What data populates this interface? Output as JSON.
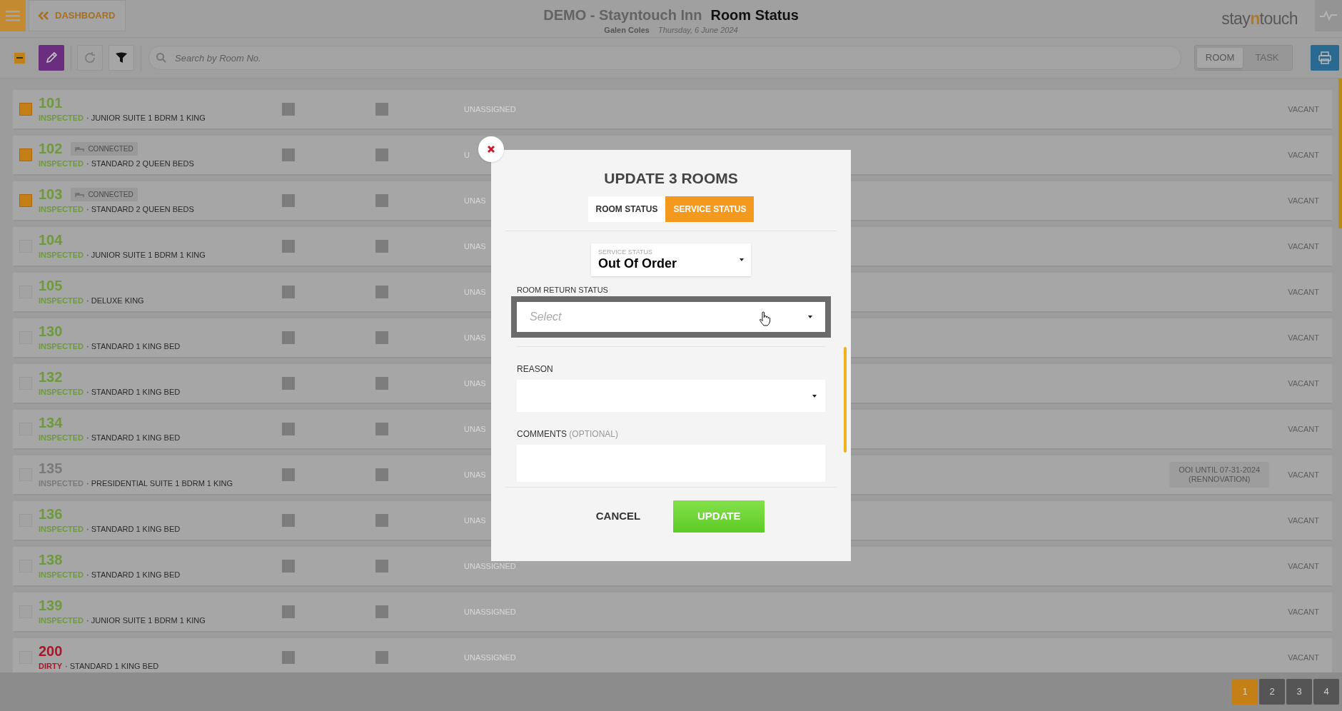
{
  "header": {
    "back_link": "DASHBOARD",
    "hotel": "DEMO - Stayntouch Inn",
    "page_title": "Room Status",
    "user": "Galen Coles",
    "date": "Thursday, 6 June 2024",
    "logo": {
      "prefix": "stay",
      "highlight": "n",
      "suffix": "touch"
    }
  },
  "toolbar": {
    "select_all_indeterminate": true,
    "search": {
      "placeholder": "Search by Room No."
    },
    "view_toggle": [
      {
        "label": "ROOM",
        "selected": true
      },
      {
        "label": "TASK",
        "selected": false
      }
    ]
  },
  "rooms": [
    {
      "number": "101",
      "status": "INSPECTED",
      "color": "#6e9a3c",
      "room_type": "· JUNIOR SUITE 1 BDRM 1 KING",
      "selected": true,
      "assignee": "UNASSIGNED",
      "occupancy": "VACANT"
    },
    {
      "number": "102",
      "badge": "CONNECTED",
      "status": "INSPECTED",
      "color": "#6e9a3c",
      "room_type": "· STANDARD 2 QUEEN BEDS",
      "selected": true,
      "assignee": "U",
      "occupancy": "VACANT"
    },
    {
      "number": "103",
      "badge": "CONNECTED",
      "status": "INSPECTED",
      "color": "#6e9a3c",
      "room_type": "· STANDARD 2 QUEEN BEDS",
      "selected": true,
      "assignee": "UNAS",
      "occupancy": "VACANT"
    },
    {
      "number": "104",
      "status": "INSPECTED",
      "color": "#6e9a3c",
      "room_type": "· JUNIOR SUITE 1 BDRM 1 KING",
      "selected": false,
      "assignee": "UNAS",
      "occupancy": "VACANT"
    },
    {
      "number": "105",
      "status": "INSPECTED",
      "color": "#6e9a3c",
      "room_type": "· DELUXE KING",
      "selected": false,
      "assignee": "UNAS",
      "occupancy": "VACANT"
    },
    {
      "number": "130",
      "status": "INSPECTED",
      "color": "#6e9a3c",
      "room_type": "· STANDARD 1 KING BED",
      "selected": false,
      "assignee": "UNAS",
      "occupancy": "VACANT"
    },
    {
      "number": "132",
      "status": "INSPECTED",
      "color": "#6e9a3c",
      "room_type": "· STANDARD 1 KING BED",
      "selected": false,
      "assignee": "UNAS",
      "occupancy": "VACANT"
    },
    {
      "number": "134",
      "status": "INSPECTED",
      "color": "#6e9a3c",
      "room_type": "· STANDARD 1 KING BED",
      "selected": false,
      "assignee": "UNAS",
      "occupancy": "VACANT"
    },
    {
      "number": "135",
      "status": "INSPECTED",
      "color": "#7a7a7a",
      "room_type": "· PRESIDENTIAL SUITE 1 BDRM 1 KING",
      "selected": false,
      "assignee": "UNAS",
      "service_note": [
        "OOI UNTIL 07-31-2024",
        "(RENNOVATION)"
      ],
      "occupancy": "VACANT"
    },
    {
      "number": "136",
      "status": "INSPECTED",
      "color": "#6e9a3c",
      "room_type": "· STANDARD 1 KING BED",
      "selected": false,
      "assignee": "UNAS",
      "occupancy": "VACANT"
    },
    {
      "number": "138",
      "status": "INSPECTED",
      "color": "#6e9a3c",
      "room_type": "· STANDARD 1 KING BED",
      "selected": false,
      "assignee": "UNASSIGNED",
      "occupancy": "VACANT"
    },
    {
      "number": "139",
      "status": "INSPECTED",
      "color": "#6e9a3c",
      "room_type": "· JUNIOR SUITE 1 BDRM 1 KING",
      "selected": false,
      "assignee": "UNASSIGNED",
      "occupancy": "VACANT"
    },
    {
      "number": "200",
      "status": "DIRTY",
      "color": "#a8182a",
      "room_type": "· STANDARD 1 KING BED",
      "selected": false,
      "assignee": "UNASSIGNED",
      "occupancy": "VACANT"
    }
  ],
  "pagination": [
    {
      "label": "1",
      "selected": true
    },
    {
      "label": "2",
      "selected": false
    },
    {
      "label": "3",
      "selected": false
    },
    {
      "label": "4",
      "selected": false
    }
  ],
  "modal": {
    "title": "UPDATE 3 ROOMS",
    "tabs": [
      {
        "label": "ROOM STATUS",
        "selected": false
      },
      {
        "label": "SERVICE STATUS",
        "selected": true
      }
    ],
    "service_status": {
      "label": "SERVICE STATUS",
      "value": "Out Of Order"
    },
    "room_return_status": {
      "label": "ROOM RETURN STATUS",
      "placeholder": "Select",
      "focused": true
    },
    "reason": {
      "label": "REASON"
    },
    "comments": {
      "label": "COMMENTS",
      "hint": "(OPTIONAL)"
    },
    "cancel": "CANCEL",
    "update": "UPDATE"
  }
}
